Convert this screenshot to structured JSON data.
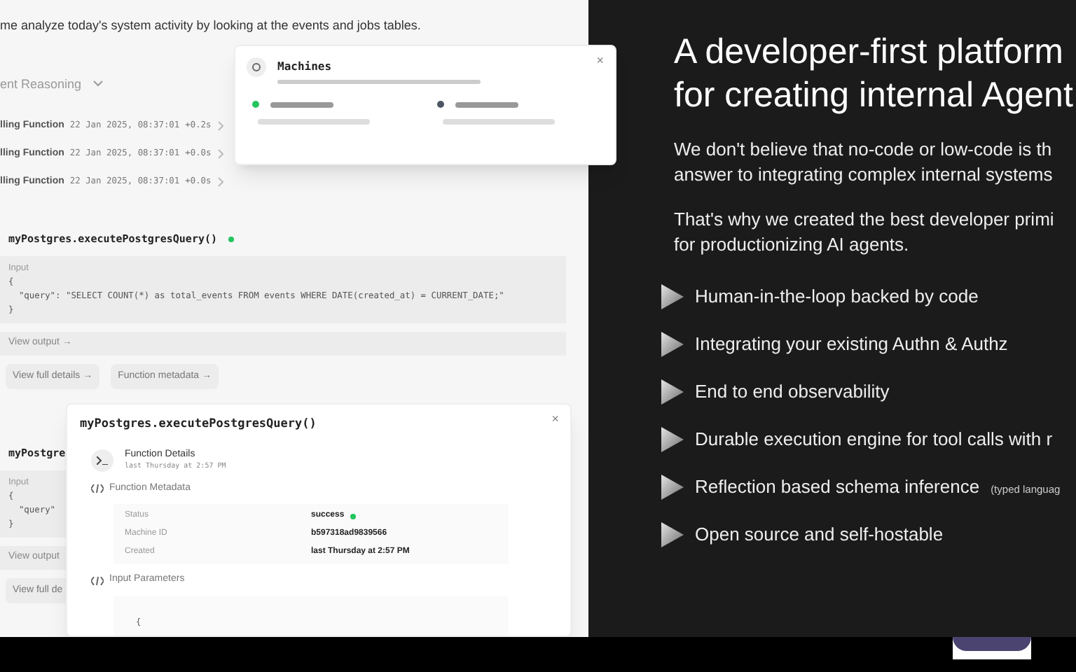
{
  "chat": {
    "intro": "me analyze today's system activity by looking at the events and jobs tables.",
    "reasoning": {
      "label": "ent Reasoning",
      "expanded": false
    },
    "calls": [
      {
        "label": "lling Function",
        "time": "22 Jan 2025, 08:37:01",
        "delta": "+0.2s"
      },
      {
        "label": "lling Function",
        "time": "22 Jan 2025, 08:37:01",
        "delta": "+0.0s"
      },
      {
        "label": "lling Function",
        "time": "22 Jan 2025, 08:37:01",
        "delta": "+0.0s"
      }
    ],
    "steps": [
      {
        "title": "myPostgres.executePostgresQuery()",
        "color": "#22c55e",
        "input_label": "Input",
        "input_lines": [
          "{",
          "  \"query\": \"SELECT COUNT(*) as total_events FROM events WHERE DATE(created_at) = CURRENT_DATE;\"",
          "}"
        ],
        "output_link": "View output →",
        "buttons": [
          "View full details →",
          "Function metadata →"
        ]
      },
      {
        "title": "myPostgre",
        "input_label": "Input",
        "input_lines": [
          "{",
          "  \"query\"",
          "}"
        ],
        "output_link": "View output",
        "buttons": [
          "View full de"
        ]
      }
    ]
  },
  "machines_popup": {
    "title": "Machines",
    "close": "×",
    "machines": [
      {
        "color": "#22c55e"
      },
      {
        "color": "#4b5563"
      }
    ]
  },
  "function_modal": {
    "title": "myPostgres.executePostgresQuery()",
    "close": "×",
    "details_title": "Function Details",
    "details_time": "last Thursday at 2:57 PM",
    "metadata_heading": "Function Metadata",
    "metadata": [
      {
        "key": "Status",
        "value": "success",
        "color": "#22c55e"
      },
      {
        "key": "Machine ID",
        "value": "b597318ad9839566"
      },
      {
        "key": "Created",
        "value": "last Thursday at 2:57 PM"
      }
    ],
    "params_heading": "Input Parameters",
    "params_open": "{"
  },
  "promo": {
    "heading": [
      "A developer-first platform",
      "for creating internal Agent"
    ],
    "paragraphs": [
      [
        "We don't believe that no-code or low-code is th",
        "answer to integrating complex internal systems"
      ],
      [
        "That's why we created the best developer primi",
        "for productionizing AI agents."
      ]
    ],
    "features": [
      {
        "text": "Human-in-the-loop backed by code"
      },
      {
        "text": "Integrating your existing Authn & Authz"
      },
      {
        "text": "End to end observability"
      },
      {
        "text": "Durable execution engine for tool calls with r"
      },
      {
        "text": "Reflection based schema inference",
        "note": "(typed languag"
      },
      {
        "text": "Open source and self-hostable"
      }
    ]
  }
}
